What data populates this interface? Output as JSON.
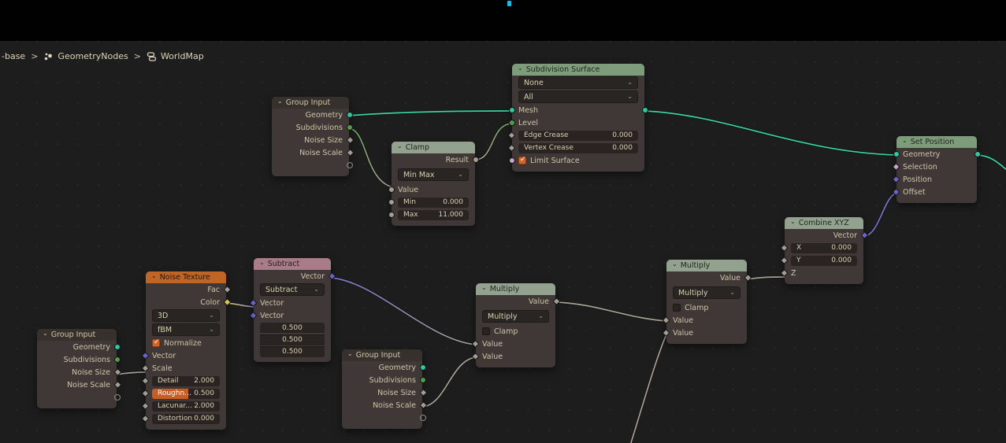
{
  "breadcrumb": {
    "root": "-base",
    "sep": ">",
    "nodetree": "GeometryNodes",
    "object": "WorldMap"
  },
  "colors": {
    "background": "#1d1d1d",
    "node_body": "#3f3836",
    "header_group_input": "#37312e",
    "header_geometry_green": "#7d9c7a",
    "header_converter_sage": "#93a28f",
    "header_texture_orange": "#bf6627",
    "header_vector_rose": "#a87c89",
    "socket_geometry": "#2fc79b",
    "socket_integer": "#569a4b",
    "socket_float": "#a39d95",
    "socket_vector": "#6a63c8",
    "socket_color": "#d5c854",
    "socket_boolean": "#c9a3cd",
    "wire_geometry": "#3bd3a2",
    "checkbox_checked": "#d66427",
    "slider_fill": "#c85d26",
    "cyan_mark": "#1fb8e0"
  },
  "nodes": {
    "group_input_top": {
      "title": "Group Input",
      "geometry": "Geometry",
      "subdivisions": "Subdivisions",
      "noise_size": "Noise Size",
      "noise_scale": "Noise Scale"
    },
    "subdivision": {
      "title": "Subdivision Surface",
      "select_uv": "None",
      "select_boundary": "All",
      "mesh": "Mesh",
      "level": "Level",
      "edge_crease": {
        "label": "Edge Crease",
        "value": "0.000"
      },
      "vertex_crease": {
        "label": "Vertex Crease",
        "value": "0.000"
      },
      "limit_surface": "Limit Surface"
    },
    "clamp": {
      "title": "Clamp",
      "result": "Result",
      "mode": "Min Max",
      "value": "Value",
      "min": {
        "label": "Min",
        "value": "0.000"
      },
      "max": {
        "label": "Max",
        "value": "11.000"
      }
    },
    "set_position": {
      "title": "Set Position",
      "geometry": "Geometry",
      "selection": "Selection",
      "position": "Position",
      "offset": "Offset"
    },
    "combine_xyz": {
      "title": "Combine XYZ",
      "vector": "Vector",
      "x": {
        "label": "X",
        "value": "0.000"
      },
      "y": {
        "label": "Y",
        "value": "0.000"
      },
      "z": "Z"
    },
    "noise_texture": {
      "title": "Noise Texture",
      "fac": "Fac",
      "color": "Color",
      "dimensions": "3D",
      "type": "fBM",
      "normalize": "Normalize",
      "vector": "Vector",
      "scale": "Scale",
      "detail": {
        "label": "Detail",
        "value": "2.000"
      },
      "roughness": {
        "label": "Roughn...",
        "value": "0.500"
      },
      "lacunarity": {
        "label": "Lacunar...",
        "value": "2.000"
      },
      "distortion": {
        "label": "Distortion",
        "value": "0.000"
      }
    },
    "subtract": {
      "title": "Subtract",
      "vector_out": "Vector",
      "mode": "Subtract",
      "vector_in1": "Vector",
      "vector_in2": "Vector",
      "values": [
        "0.500",
        "0.500",
        "0.500"
      ]
    },
    "group_input_bl": {
      "title": "Group Input",
      "geometry": "Geometry",
      "subdivisions": "Subdivisions",
      "noise_size": "Noise Size",
      "noise_scale": "Noise Scale"
    },
    "group_input_bm": {
      "title": "Group Input",
      "geometry": "Geometry",
      "subdivisions": "Subdivisions",
      "noise_size": "Noise Size",
      "noise_scale": "Noise Scale"
    },
    "multiply_1": {
      "title": "Multiply",
      "value_out": "Value",
      "mode": "Multiply",
      "clamp": "Clamp",
      "value_in1": "Value",
      "value_in2": "Value"
    },
    "multiply_2": {
      "title": "Multiply",
      "value_out": "Value",
      "mode": "Multiply",
      "clamp": "Clamp",
      "value_in1": "Value",
      "value_in2": "Value"
    }
  }
}
